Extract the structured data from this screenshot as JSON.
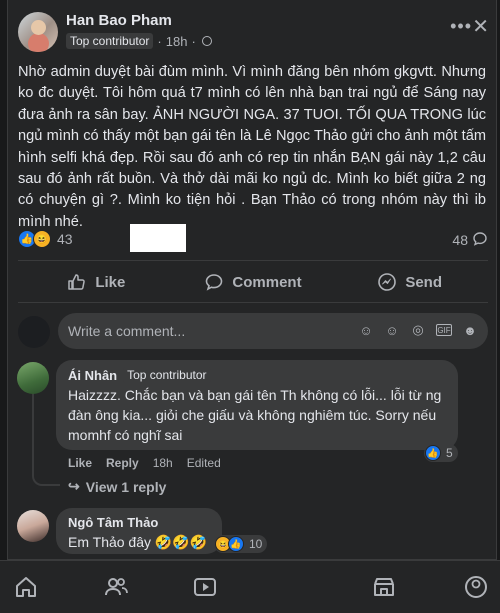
{
  "post": {
    "author": "Han Bao Pham",
    "badge": "Top contributor",
    "time": "18h",
    "separator": "·",
    "body": "Nhờ admin duyệt bài đùm mình. Vì mình đăng bên nhóm gkgvtt. Nhưng ko đc duyệt. Tôi hôm quá t7 mình có lên nhà bạn trai ngủ để Sáng nay đưa ảnh ra sân bay. ẢNH NGƯỜI NGA. 37 TUOI. TỐI QUA TRONG lúc ngủ mình có thấy một bạn gái tên là Lê Ngọc Thảo gửi cho ảnh một tấm hình selfi khá đẹp. Rồi sau đó anh có rep tin nhắn BẠN gái này 1,2 câu sau đó ảnh rất buồn. Và thở dài mãi ko ngủ dc. Mình ko biết giữa 2 ng có chuyện gì ?. Mình ko tiện hỏi . Bạn Thảo có trong nhóm này thì ib mình nhé.",
    "reaction_count": "43",
    "comment_count": "48"
  },
  "actions": {
    "like": "Like",
    "comment": "Comment",
    "send": "Send"
  },
  "write_comment": {
    "placeholder": "Write a comment..."
  },
  "comments": [
    {
      "name": "Ái Nhân",
      "badge": "Top contributor",
      "text": "Haizzzz. Chắc bạn và bạn gái tên Th không có lỗi... lỗi từ ng đàn ông kia... giỏi che giấu và không nghiêm túc. Sorry nếu momhf có nghĩ sai",
      "like": "Like",
      "reply": "Reply",
      "time": "18h",
      "edited": "Edited",
      "reactions": "5",
      "view_replies": "View 1 reply"
    },
    {
      "name": "Ngô Tâm Thảo",
      "text": "Em Thảo đây 🤣🤣🤣",
      "reactions": "10"
    }
  ],
  "icons": {
    "dots": "more-options-icon",
    "close": "close-icon"
  },
  "colors": {
    "background": "#18191a",
    "card": "#242526",
    "bubble": "#3a3b3c",
    "accent": "#1877f2",
    "text": "#e4e6eb",
    "muted": "#b0b3b8"
  }
}
